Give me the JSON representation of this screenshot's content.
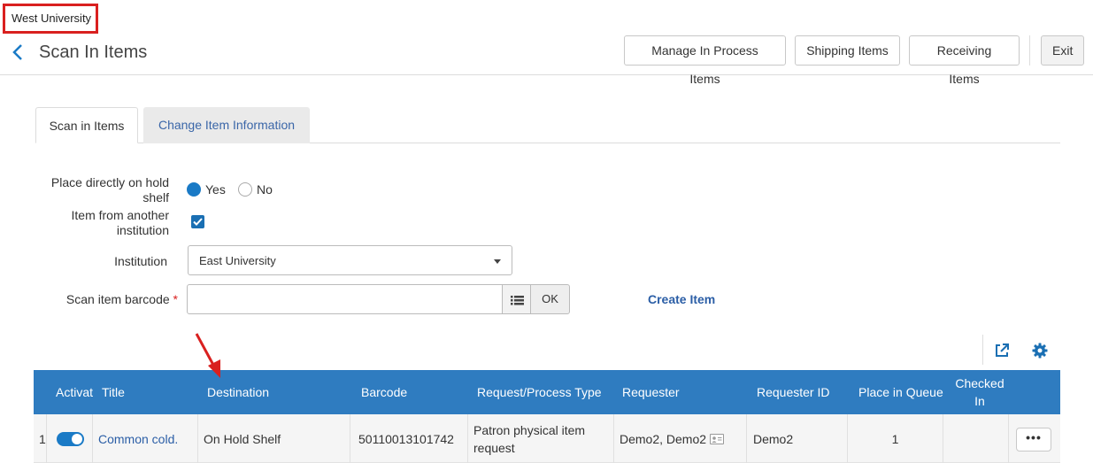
{
  "institution_badge": "West University",
  "header": {
    "title": "Scan In Items",
    "buttons": {
      "manage": "Manage In Process Items",
      "shipping": "Shipping Items",
      "receiving": "Receiving Items",
      "exit": "Exit"
    }
  },
  "tabs": [
    {
      "label": "Scan in Items",
      "active": true
    },
    {
      "label": "Change Item Information",
      "active": false
    }
  ],
  "form": {
    "hold_shelf": {
      "label_line1": "Place directly on hold",
      "label_line2": "shelf",
      "options": [
        "Yes",
        "No"
      ],
      "selected": "Yes"
    },
    "another_institution": {
      "label_line1": "Item from another",
      "label_line2": "institution",
      "checked": true
    },
    "institution": {
      "label": "Institution",
      "value": "East University"
    },
    "barcode": {
      "label": "Scan item barcode",
      "required_mark": "*",
      "value": "",
      "ok_label": "OK"
    },
    "create_item": "Create Item"
  },
  "table": {
    "columns": [
      "Activat",
      "Title",
      "Destination",
      "Barcode",
      "Request/Process Type",
      "Requester",
      "Requester ID",
      "Place in Queue",
      "Checked In"
    ],
    "checked_in_line1": "Checked",
    "checked_in_line2": "In",
    "rows": [
      {
        "index": "1",
        "active": true,
        "title": "Common cold.",
        "destination": "On Hold Shelf",
        "barcode": "50110013101742",
        "type_line1": "Patron physical item",
        "type_line2": "request",
        "requester": "Demo2, Demo2",
        "requester_id": "Demo2",
        "place_in_queue": "1",
        "checked_in": "",
        "more_label": "•••"
      }
    ]
  },
  "icons": {
    "back": "chevron-left-icon",
    "list": "list-icon",
    "export": "export-icon",
    "settings": "gear-icon",
    "requester_card": "id-card-icon"
  },
  "colors": {
    "accent": "#1a7ac6",
    "table_header": "#2f7cc0",
    "link": "#2b5ea6",
    "annotation": "#d9201f"
  }
}
